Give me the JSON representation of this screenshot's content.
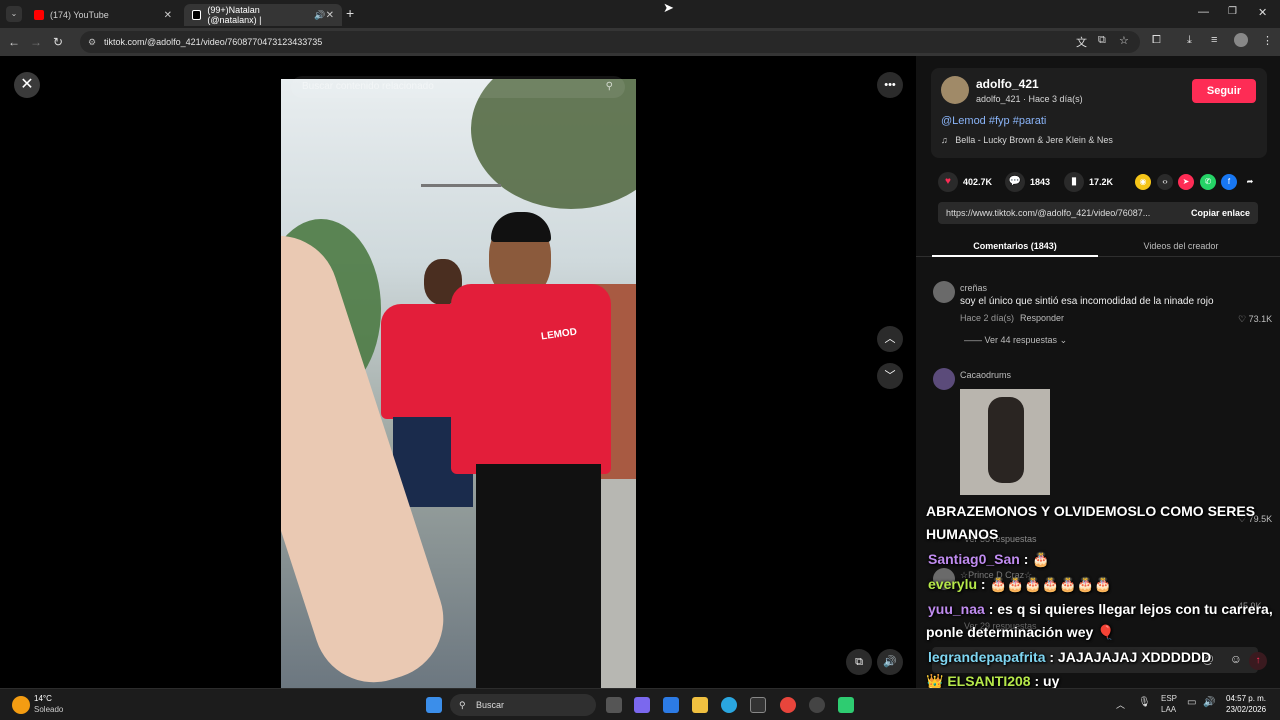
{
  "browser": {
    "tabs": [
      {
        "label": "(174) YouTube"
      },
      {
        "label": "(99+)Natalan (@natalanx) |"
      }
    ],
    "url": "tiktok.com/@adolfo_421/video/7608770473123433735"
  },
  "video": {
    "search_placeholder": "Buscar contenido relacionado",
    "shirt_text": "LEMOD"
  },
  "author": {
    "name": "adolfo_421",
    "meta": "adolfo_421 · Hace 3 día(s)",
    "follow_label": "Seguir",
    "caption": "@Lemod #fyp #parati",
    "music": "Bella - Lucky Brown & Jere Klein & Nes"
  },
  "stats": {
    "likes": "402.7K",
    "comments": "1843",
    "saves": "17.2K"
  },
  "share": {
    "link": "https://www.tiktok.com/@adolfo_421/video/76087...",
    "copy_label": "Copiar enlace"
  },
  "panel_tabs": {
    "comments": "Comentarios (1843)",
    "creator_videos": "Videos del creador"
  },
  "comments": [
    {
      "name": "creñas",
      "text": "soy el único que sintió esa incomodidad de la ninade rojo",
      "time": "Hace 2 día(s)",
      "reply": "Responder",
      "likes": "73.1K",
      "replies": "Ver 44 respuestas"
    },
    {
      "name": "Cacaodrums",
      "likes": "79.5K",
      "replies": "Ver 58 respuestas"
    },
    {
      "name": "☆Prince D Craz☆",
      "likes": "45.9K",
      "replies": "Ver 29 respuestas"
    }
  ],
  "chat": [
    {
      "line": "ABRAZEMONOS Y OLVIDEMOSLO COMO SERES"
    },
    {
      "line": "HUMANOS"
    },
    {
      "user": "Santiag0_San",
      "msg": " : 🎂"
    },
    {
      "user": "everylu",
      "msg": " : 🎂🎂🎂🎂🎂🎂🎂"
    },
    {
      "user": "yuu_naa",
      "msg": " : es q si quieres llegar lejos con tu carrera,"
    },
    {
      "line": "ponle determinación wey 🎈"
    },
    {
      "user": "legrandepapafrita",
      "msg": " : JAJAJAJAJ XDDDDDD"
    },
    {
      "user": "ELSANTI208",
      "msg": " : uy"
    }
  ],
  "taskbar": {
    "weather_temp": "14°C",
    "weather_text": "Soleado",
    "search_label": "Buscar",
    "lang": "ESP",
    "lang2": "LAA",
    "time": "04:57 p. m.",
    "date": "23/02/2026"
  }
}
